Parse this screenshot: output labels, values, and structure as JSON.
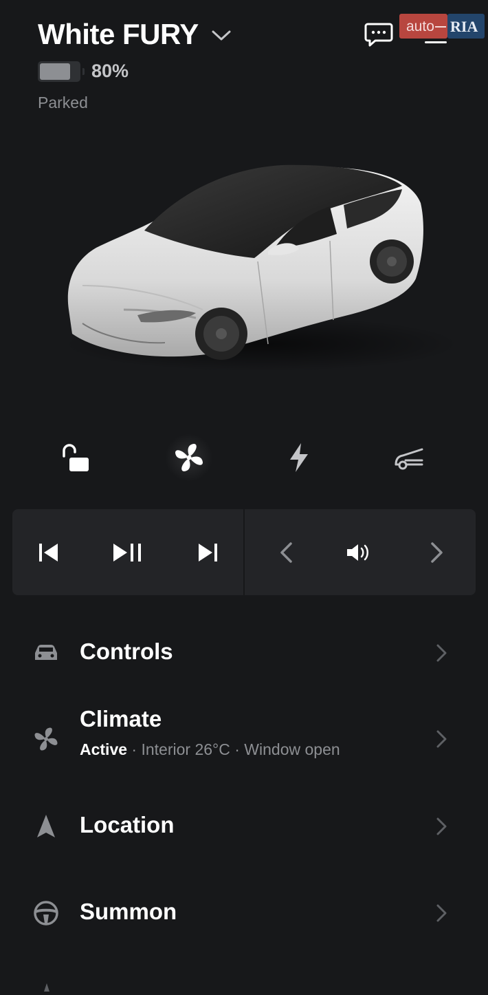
{
  "header": {
    "car_name": "White FURY",
    "battery_percent": "80%",
    "battery_level": 0.8,
    "status": "Parked"
  },
  "watermark": {
    "text": "auto RIA"
  },
  "quick_actions": [
    {
      "name": "unlock",
      "icon": "unlock-icon"
    },
    {
      "name": "climate",
      "icon": "fan-icon",
      "active": true
    },
    {
      "name": "charge",
      "icon": "lightning-icon"
    },
    {
      "name": "frunk",
      "icon": "frunk-icon"
    }
  ],
  "media": {
    "controls": [
      "previous-track",
      "play-pause",
      "next-track",
      "source-prev",
      "volume",
      "source-next"
    ]
  },
  "menu": {
    "controls": {
      "label": "Controls"
    },
    "climate": {
      "label": "Climate",
      "status": "Active",
      "detail": " · Interior 26°C · Window open"
    },
    "location": {
      "label": "Location"
    },
    "summon": {
      "label": "Summon"
    }
  },
  "colors": {
    "background": "#17181a",
    "panel": "#232427",
    "text_primary": "#ffffff",
    "text_secondary": "#8d8f93"
  }
}
